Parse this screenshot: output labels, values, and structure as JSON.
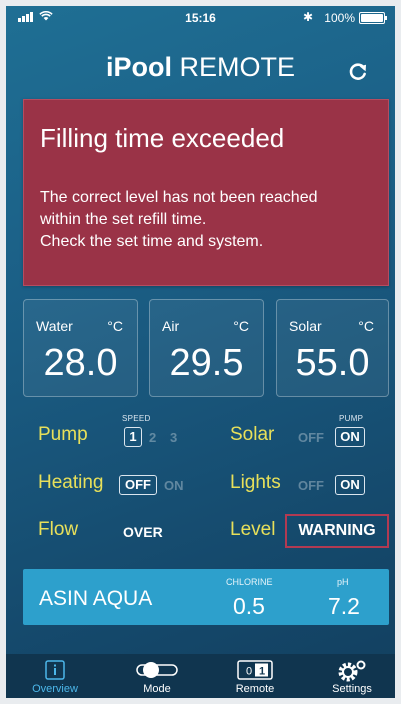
{
  "status_bar": {
    "time": "15:16",
    "bluetooth": "✱",
    "battery": "100%"
  },
  "header": {
    "brand": "iPool",
    "subtitle": "REMOTE",
    "refresh_icon": "refresh-icon"
  },
  "alert": {
    "title": "Filling time exceeded",
    "lines": [
      "The correct level has not been reached",
      "within the set refill time.",
      "Check the set time and system."
    ]
  },
  "temps": [
    {
      "name": "Water",
      "unit": "°C",
      "value": "28.0"
    },
    {
      "name": "Air",
      "unit": "°C",
      "value": "29.5"
    },
    {
      "name": "Solar",
      "unit": "°C",
      "value": "55.0"
    }
  ],
  "controls": {
    "pump": {
      "label": "Pump",
      "speed_caption": "SPEED",
      "speeds": [
        "1",
        "2",
        "3"
      ],
      "selected": "1"
    },
    "solar": {
      "label": "Solar",
      "caption": "PUMP",
      "off": "OFF",
      "on": "ON",
      "state": "on"
    },
    "heating": {
      "label": "Heating",
      "off": "OFF",
      "on": "ON",
      "state": "off"
    },
    "lights": {
      "label": "Lights",
      "off": "OFF",
      "on": "ON",
      "state": "on"
    },
    "flow": {
      "label": "Flow",
      "value": "OVER"
    },
    "level": {
      "label": "Level",
      "value": "WARNING"
    }
  },
  "water_quality": {
    "name": "ASIN AQUA",
    "chlorine_label": "CHLORINE",
    "chlorine": "0.5",
    "ph_label": "pH",
    "ph": "7.2"
  },
  "tabs": [
    {
      "label": "Overview",
      "icon": "info-icon",
      "active": true
    },
    {
      "label": "Mode",
      "icon": "toggle-icon",
      "active": false
    },
    {
      "label": "Remote",
      "icon": "switch-icon",
      "active": false
    },
    {
      "label": "Settings",
      "icon": "gear-icon",
      "active": false
    }
  ],
  "colors": {
    "accent": "#e8e05a",
    "alert": "#9a3347",
    "warning_border": "#b23a52",
    "water_bar": "#2da0cc",
    "tab_active": "#4cb7ea"
  }
}
